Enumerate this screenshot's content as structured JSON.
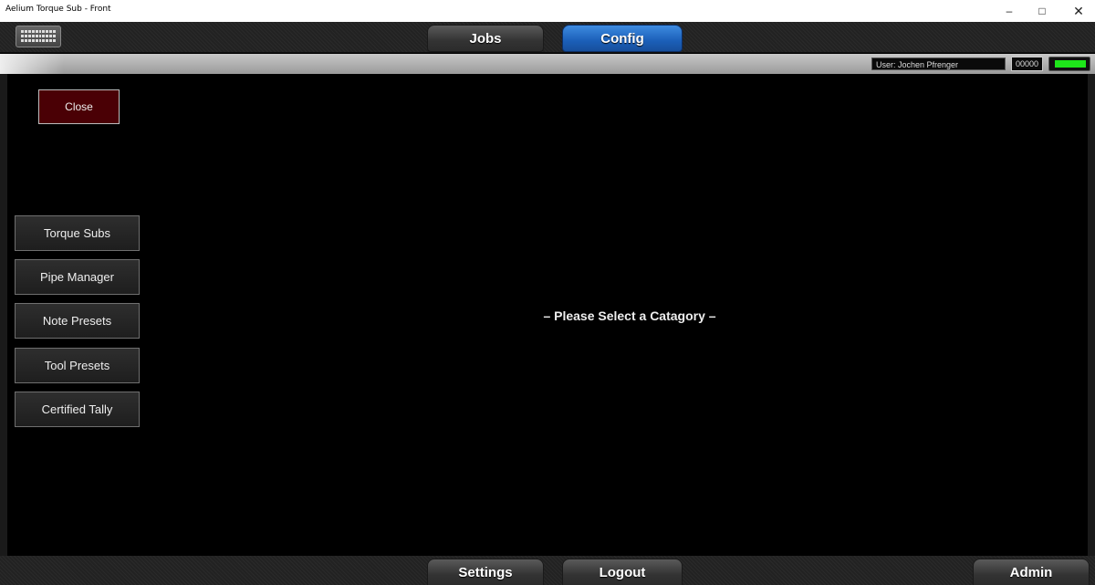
{
  "window": {
    "title": "Aelium Torque Sub - Front",
    "min_glyph": "–",
    "max_glyph": "□",
    "close_glyph": "✕"
  },
  "topbar": {
    "keyboard_icon": "keyboard-icon",
    "tabs": [
      {
        "label": "Jobs",
        "active": false
      },
      {
        "label": "Config",
        "active": true
      }
    ]
  },
  "status": {
    "user": "User: Jochen Pfrenger",
    "counter": "00000",
    "indicator_color": "#1ee61a"
  },
  "sidebar": {
    "close_label": "Close",
    "items": [
      {
        "label": "Torque Subs"
      },
      {
        "label": "Pipe Manager"
      },
      {
        "label": "Note Presets"
      },
      {
        "label": "Tool Presets"
      },
      {
        "label": "Certified Tally"
      }
    ]
  },
  "main": {
    "message": "– Please Select a Catagory –"
  },
  "bottombar": {
    "settings_label": "Settings",
    "logout_label": "Logout",
    "admin_label": "Admin"
  },
  "colors": {
    "active_tab": "#1b5fb8",
    "close_button": "#4a0005",
    "background": "#000000"
  }
}
